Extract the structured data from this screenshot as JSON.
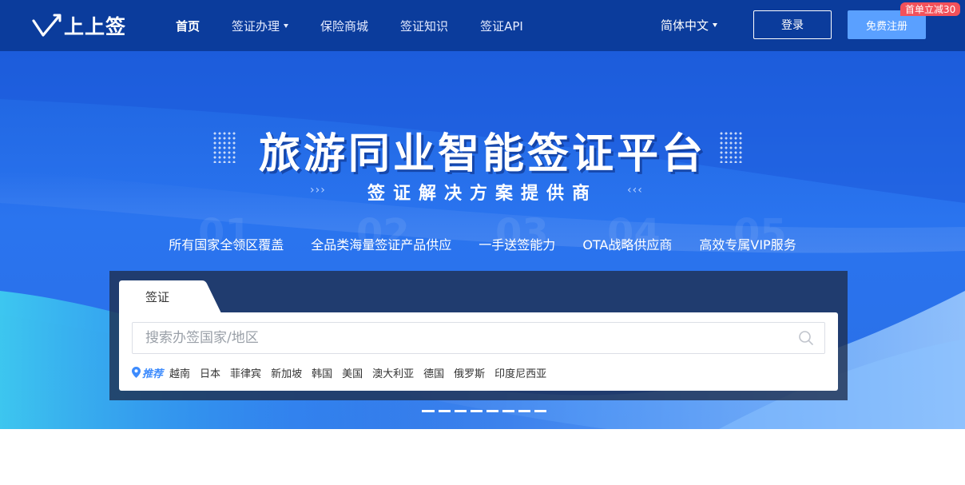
{
  "brand": {
    "name": "上上签"
  },
  "nav": {
    "links": [
      {
        "label": "首页",
        "active": true
      },
      {
        "label": "签证办理",
        "dropdown": true
      },
      {
        "label": "保险商城"
      },
      {
        "label": "签证知识"
      },
      {
        "label": "签证API"
      }
    ],
    "language": "简体中文",
    "login_label": "登录",
    "register_label": "免费注册",
    "promo_badge": "首单立减30"
  },
  "hero": {
    "title": "旅游同业智能签证平台",
    "subtitle": "签证解决方案提供商",
    "bg_numbers": [
      "01",
      "02",
      "03",
      "04",
      "05"
    ],
    "features": [
      "所有国家全领区覆盖",
      "全品类海量签证产品供应",
      "一手送签能力",
      "OTA战略供应商",
      "高效专属VIP服务"
    ]
  },
  "search": {
    "tab_label": "签证",
    "placeholder": "搜索办签国家/地区",
    "value": "",
    "recommend_label": "推荐",
    "recommend_items": [
      "越南",
      "日本",
      "菲律宾",
      "新加坡",
      "韩国",
      "美国",
      "澳大利亚",
      "德国",
      "俄罗斯",
      "印度尼西亚"
    ]
  },
  "carousel": {
    "slide_count": 8,
    "active_index": 0
  },
  "colors": {
    "nav_bg": "#0b3c9c",
    "hero_blue": "#2a74ef",
    "accent": "#3d8bfd",
    "register_btn": "#5aa0ff",
    "promo_red": "#f2515a"
  }
}
